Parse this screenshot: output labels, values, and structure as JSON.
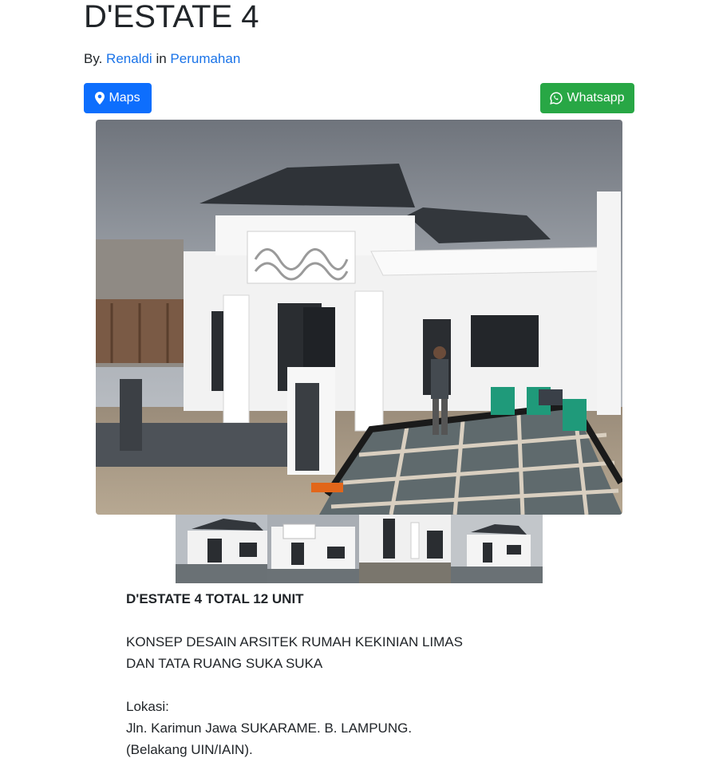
{
  "post": {
    "title": "D'ESTATE 4",
    "by_prefix": "By.",
    "author": "Renaldi",
    "in_word": "in",
    "category": "Perumahan"
  },
  "buttons": {
    "maps_label": "Maps",
    "maps_icon": "map-marker-icon",
    "whatsapp_label": "Whatsapp",
    "whatsapp_icon": "whatsapp-icon",
    "maps_color": "#0d6efd",
    "whatsapp_color": "#28a745"
  },
  "description": {
    "heading": "D'ESTATE 4 TOTAL 12 UNIT",
    "concept_line1": "KONSEP DESAIN ARSITEK RUMAH KEKINIAN LIMAS",
    "concept_line2": "DAN TATA RUANG SUKA SUKA",
    "location_label": "Lokasi:",
    "location_line1": "Jln. Karimun Jawa SUKARAME. B. LAMPUNG.",
    "location_line2": "(Belakang UIN/IAIN)."
  },
  "colors": {
    "link": "#1a73e8",
    "text": "#212529"
  }
}
